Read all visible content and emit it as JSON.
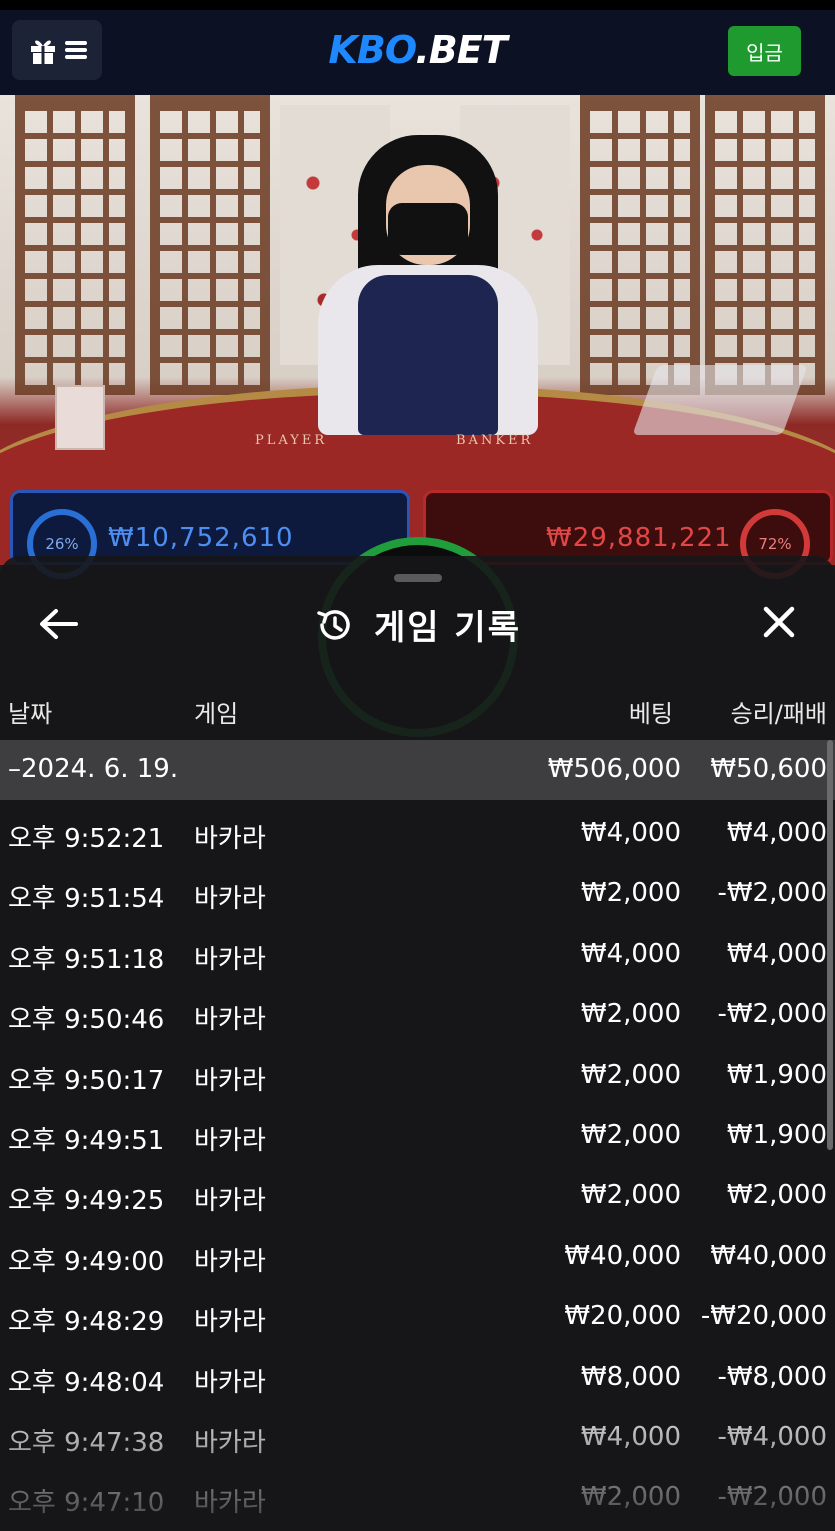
{
  "header": {
    "logo_kbo": "KBO",
    "logo_bet": ".BET",
    "deposit_label": "입금"
  },
  "table": {
    "player_label": "PLAYER",
    "banker_label": "BANKER",
    "player_pct": "26%",
    "banker_pct": "72%",
    "player_amount": "₩10,752,610",
    "banker_amount": "₩29,881,221"
  },
  "history": {
    "title": "게임 기록",
    "columns": {
      "date": "날짜",
      "game": "게임",
      "bet": "베팅",
      "result": "승리/패배"
    },
    "date_row": {
      "date": "–2024. 6. 19.",
      "bet": "₩506,000",
      "result": "₩50,600"
    },
    "rows": [
      {
        "time": "오후 9:52:21",
        "game": "바카라",
        "bet": "₩4,000",
        "result": "₩4,000"
      },
      {
        "time": "오후 9:51:54",
        "game": "바카라",
        "bet": "₩2,000",
        "result": "-₩2,000"
      },
      {
        "time": "오후 9:51:18",
        "game": "바카라",
        "bet": "₩4,000",
        "result": "₩4,000"
      },
      {
        "time": "오후 9:50:46",
        "game": "바카라",
        "bet": "₩2,000",
        "result": "-₩2,000"
      },
      {
        "time": "오후 9:50:17",
        "game": "바카라",
        "bet": "₩2,000",
        "result": "₩1,900"
      },
      {
        "time": "오후 9:49:51",
        "game": "바카라",
        "bet": "₩2,000",
        "result": "₩1,900"
      },
      {
        "time": "오후 9:49:25",
        "game": "바카라",
        "bet": "₩2,000",
        "result": "₩2,000"
      },
      {
        "time": "오후 9:49:00",
        "game": "바카라",
        "bet": "₩40,000",
        "result": "₩40,000"
      },
      {
        "time": "오후 9:48:29",
        "game": "바카라",
        "bet": "₩20,000",
        "result": "-₩20,000"
      },
      {
        "time": "오후 9:48:04",
        "game": "바카라",
        "bet": "₩8,000",
        "result": "-₩8,000"
      },
      {
        "time": "오후 9:47:38",
        "game": "바카라",
        "bet": "₩4,000",
        "result": "-₩4,000"
      },
      {
        "time": "오후 9:47:10",
        "game": "바카라",
        "bet": "₩2,000",
        "result": "-₩2,000"
      }
    ]
  },
  "colors": {
    "accent": "#1e88ff",
    "deposit": "#1e9a2f",
    "player": "#2a6fd6",
    "banker": "#d23a3a"
  }
}
